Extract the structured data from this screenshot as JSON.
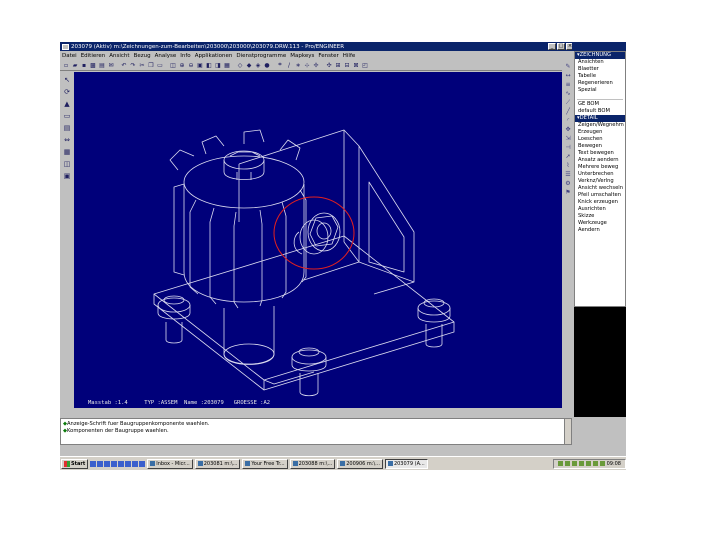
{
  "window": {
    "title": "203079 (Aktiv)  m:\\Zeichnungen-zum-Bearbeiten\\203000\\203000\\203079.DRW.113 - Pro/ENGINEER",
    "min_label": "_",
    "max_label": "□",
    "close_label": "×"
  },
  "menubar": [
    "Datei",
    "Editieren",
    "Ansicht",
    "Bezug",
    "Analyse",
    "Info",
    "Applikationen",
    "Dienstprogramme",
    "Mapkeys",
    "Fenster",
    "Hilfe"
  ],
  "menu_manager": {
    "header_zeichnung": "▾ZEICHNUNG",
    "zeichnung_items": [
      "Ansichten",
      "Blaetter",
      "Tabelle",
      "Regenerieren",
      "Spezial"
    ],
    "bom_items": [
      "GE BOM",
      "default BOM"
    ],
    "header_detail": "▾DETAIL",
    "detail_items": [
      "Zeigen/Wegnehm",
      "Erzeugen",
      "Loeschen",
      "Bewegen",
      "Text bewegen",
      "Ansatz aendern",
      "Mehrere beweg",
      "Unterbrechen",
      "Verknz/Verlng",
      "Ansicht wechseln",
      "Pfeil umschalten",
      "Knick erzeugen",
      "Ausrichten",
      "Skizze",
      "Werkzeuge",
      "Aendern"
    ]
  },
  "viewport": {
    "status_line": "Masstab :1.4     TYP :ASSEM  Name :203079   GROESSE :A2"
  },
  "messages": [
    "Anzeige-Schrift fuer Baugruppenkomponente waehlen.",
    "Komponenten der Baugruppe waehlen."
  ],
  "taskbar": {
    "start_label": "Start",
    "tasks": [
      "Inbox - Micr...",
      "203081  m:\\...",
      "Your Free Tr...",
      "203088  m:\\...",
      "200906  m:\\...",
      "203079 (A..."
    ],
    "active_task_index": 5,
    "clock": "09:08"
  },
  "colors": {
    "viewport_bg": "#00007a",
    "drawing_lines": "#dcdcf0",
    "highlight_circle": "#e02020",
    "titlebar": "#0a246a"
  }
}
